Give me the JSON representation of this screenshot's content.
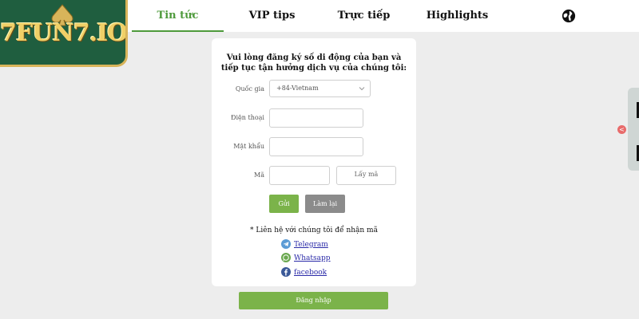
{
  "logo": {
    "text": "7FUN7.IO"
  },
  "nav": {
    "items": [
      {
        "label": "Tin tức",
        "active": true
      },
      {
        "label": "VIP tips"
      },
      {
        "label": "Trực tiếp"
      },
      {
        "label": "Highlights"
      }
    ],
    "language_icon": "globe-icon"
  },
  "form": {
    "title": "Vui lòng đăng ký số di động của bạn và tiếp tục tận hưởng dịch vụ của chúng tôi:",
    "country_label": "Quốc gia",
    "country_value": "+84-Vietnam",
    "phone_label": "Điện thoại",
    "phone_value": "",
    "password_label": "Mật khẩu",
    "password_value": "",
    "code_label": "Mã",
    "code_value": "",
    "get_code_label": "Lấy mã",
    "submit_label": "Gửi",
    "reset_label": "Làm lại"
  },
  "contact": {
    "note": "* Liên hệ với chúng tôi để nhận mã",
    "links": [
      {
        "label": "Telegram",
        "icon": "telegram-icon",
        "color": "#5b9bd5"
      },
      {
        "label": "Whatsapp",
        "icon": "whatsapp-icon",
        "color": "#6aa84f"
      },
      {
        "label": "facebook",
        "icon": "facebook-icon",
        "color": "#3b5998"
      }
    ]
  },
  "login_label": "Đăng nhập",
  "side_badge": "<",
  "colors": {
    "accent": "#4e9a3b",
    "button_green": "#7bb34a",
    "button_gray": "#8b8b8b",
    "logo_bg": "#1f5e3f",
    "logo_gold": "#d8b45a"
  }
}
